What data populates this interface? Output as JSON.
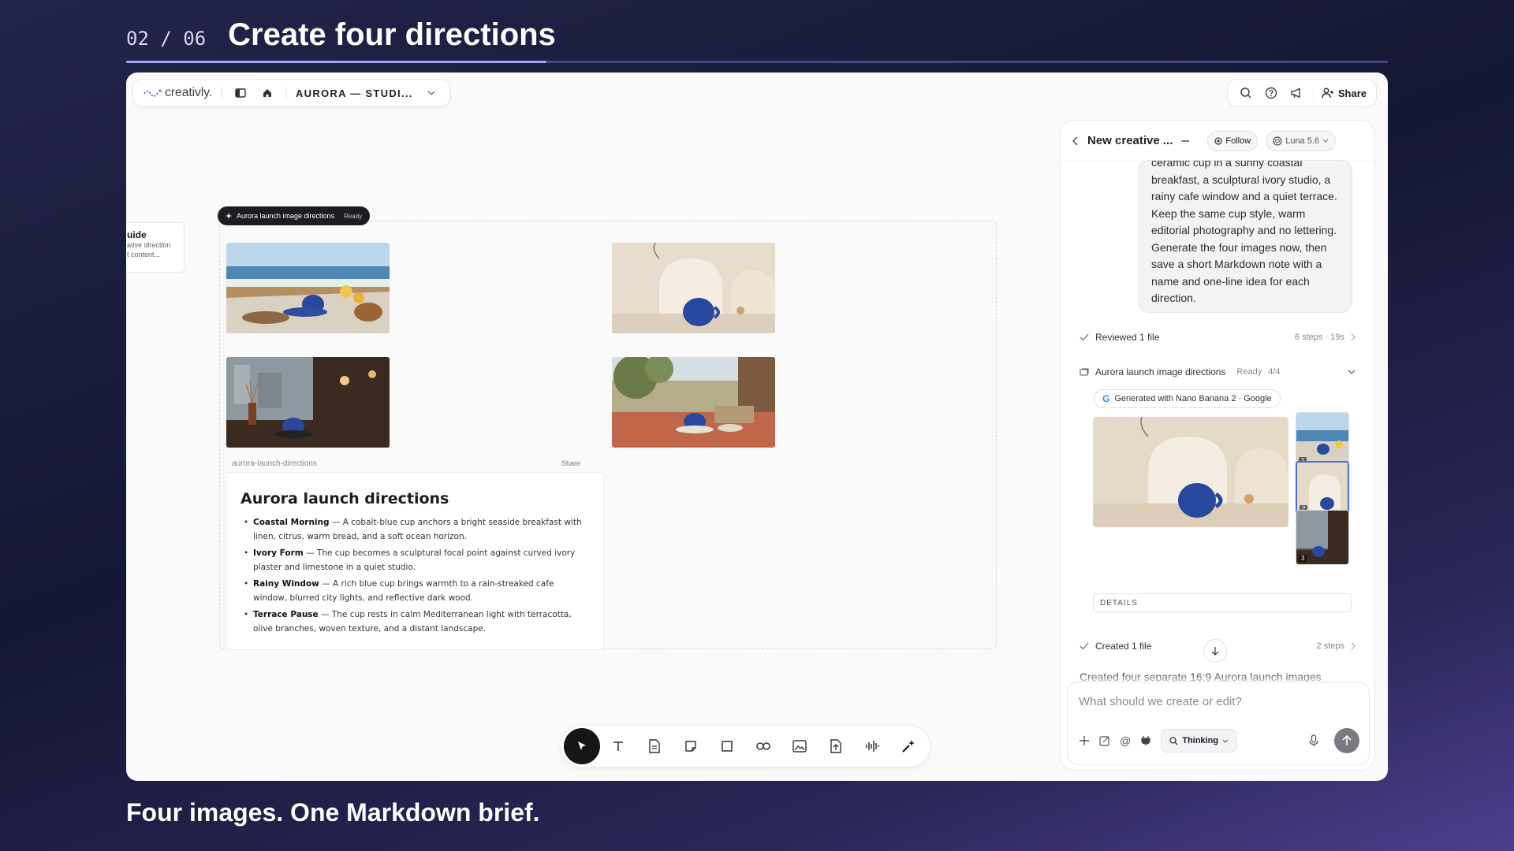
{
  "slide": {
    "counter": "02 / 06",
    "title": "Create four directions",
    "caption": "Four images. One Markdown brief.",
    "progress_fraction": 0.333
  },
  "topbar": {
    "logo": "creativly.",
    "project": "AURORA — STUDI...",
    "share_label": "Share",
    "icons": [
      "sidebar-icon",
      "home-icon",
      "chevron-down-icon",
      "search-icon",
      "help-icon",
      "megaphone-icon",
      "add-user-icon"
    ]
  },
  "canvas": {
    "frame_label": "Aurora launch image directions",
    "frame_status": "Ready",
    "guide": {
      "title": "uide",
      "line1": "ative direction",
      "line2": "t content..."
    },
    "images": [
      "Coastal Morning",
      "Ivory Form",
      "Rainy Window",
      "Terrace Pause"
    ],
    "doc_filename": "aurora-launch-directions",
    "doc_share": "Share",
    "doc": {
      "title": "Aurora launch directions",
      "items": [
        {
          "name": "Coastal Morning",
          "text": " — A cobalt-blue cup anchors a bright seaside breakfast with linen, citrus, warm bread, and a soft ocean horizon."
        },
        {
          "name": "Ivory Form",
          "text": " — The cup becomes a sculptural focal point against curved ivory plaster and limestone in a quiet studio."
        },
        {
          "name": "Rainy Window",
          "text": " — A rich blue cup brings warmth to a rain-streaked cafe window, blurred city lights, and reflective dark wood."
        },
        {
          "name": "Terrace Pause",
          "text": " — The cup rests in calm Mediterranean light with terracotta, olive branches, woven texture, and a distant landscape."
        }
      ]
    }
  },
  "toolbar": {
    "tools": [
      "select-tool",
      "text-tool",
      "document-tool",
      "sticky-note-tool",
      "shape-tool",
      "link-tool",
      "image-tool",
      "upload-tool",
      "audio-tool",
      "ai-magic-tool"
    ]
  },
  "chat": {
    "title": "New creative ...",
    "follow_label": "Follow",
    "model_label": "Luna 5.6",
    "message": "ceramic cup in a sunny coastal breakfast, a sculptural ivory studio, a rainy cafe window and a quiet terrace. Keep the same cup style, warm editorial photography and no lettering. Generate the four images now, then save a short Markdown note with a name and one-line idea for each direction.",
    "step1": {
      "label": "Reviewed 1 file",
      "meta": "6 steps · 19s"
    },
    "artifact": {
      "label": "Aurora launch image directions",
      "status": "Ready",
      "count": "4/4"
    },
    "generated_with": "Generated with Nano Banana 2 · Google",
    "thumb_numbers": [
      "1",
      "2",
      "3"
    ],
    "details_label": "DETAILS",
    "step2": {
      "label": "Created 1 file",
      "meta": "2 steps"
    },
    "tail_text": "Created four separate 16:9 Aurora launch images",
    "composer_placeholder": "What should we create or edit?",
    "thinking_label": "Thinking"
  },
  "colors": {
    "accent": "#a4a7f0",
    "cup_blue": "#27489e",
    "dark_pill": "#1d1d21"
  }
}
